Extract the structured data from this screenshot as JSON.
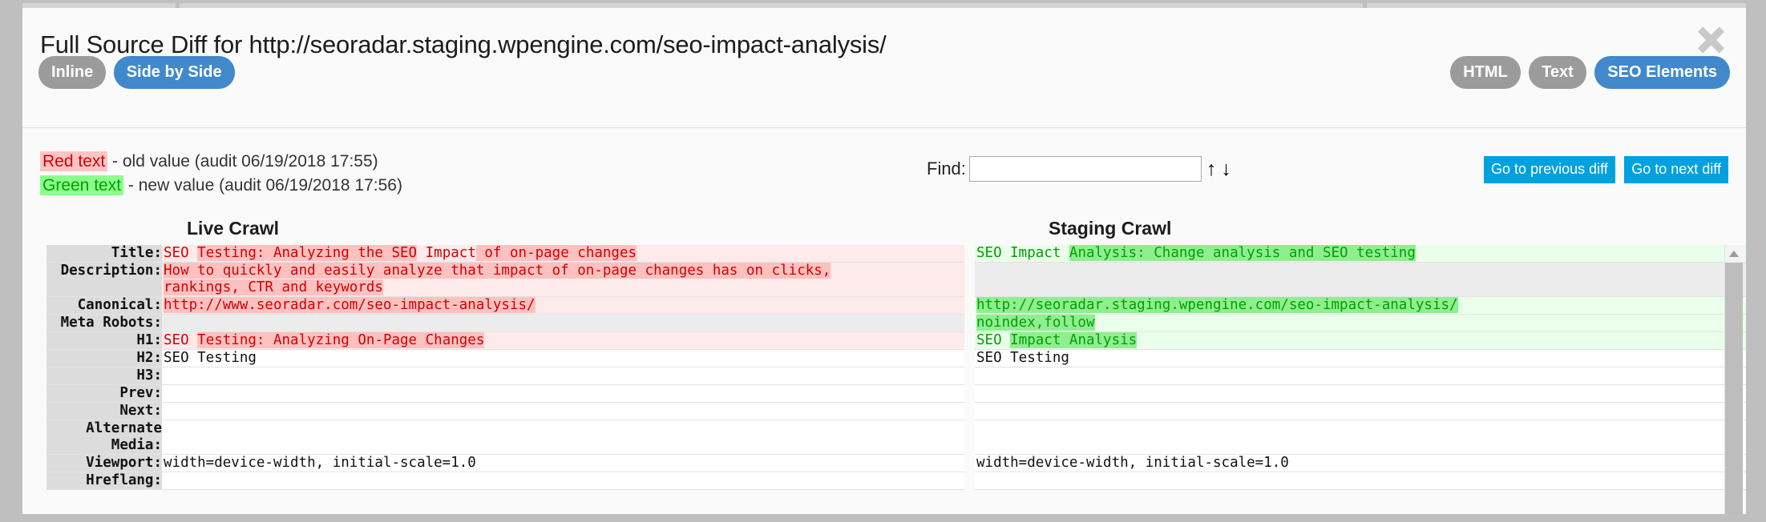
{
  "header": {
    "title": "Full Source Diff for http://seoradar.staging.wpengine.com/seo-impact-analysis/",
    "close_icon": "close-icon",
    "view_modes": [
      {
        "label": "Inline",
        "active": false
      },
      {
        "label": "Side by Side",
        "active": true
      }
    ],
    "format_modes": [
      {
        "label": "HTML",
        "active": false
      },
      {
        "label": "Text",
        "active": false
      },
      {
        "label": "SEO Elements",
        "active": true
      }
    ]
  },
  "toolbar": {
    "legend": [
      {
        "swatch": "Red text",
        "text": " - old value (audit 06/19/2018 17:55)",
        "color": "#d40000",
        "bg": "#ffc4c4"
      },
      {
        "swatch": "Green text",
        "text": " - new value (audit 06/19/2018 17:56)",
        "color": "#00a000",
        "bg": "#8cff8c"
      }
    ],
    "find_label": "Find:",
    "find_value": "",
    "find_placeholder": "",
    "find_up_icon": "↑",
    "find_down_icon": "↓",
    "prev_diff_label": "Go to previous diff",
    "next_diff_label": "Go to next diff"
  },
  "columns": {
    "left_heading": "Live Crawl",
    "right_heading": "Staging Crawl"
  },
  "rows": [
    {
      "label": "Title:",
      "left": {
        "kind": "del",
        "segments": [
          {
            "t": "SEO ",
            "hl": false
          },
          {
            "t": "Testing: Analyzing the SEO",
            "hl": true
          },
          {
            "t": " ",
            "hl": false
          },
          {
            "t": "Impact",
            "hl": false
          },
          {
            "t": " of on-page changes",
            "hl": true
          }
        ]
      },
      "right": {
        "kind": "ins",
        "segments": [
          {
            "t": "SEO Impact ",
            "hl": false
          },
          {
            "t": "Analysis: Change analysis and SEO testing",
            "hl": true
          }
        ]
      }
    },
    {
      "label": "Description:",
      "left": {
        "kind": "del",
        "lines": 2,
        "segments": [
          {
            "t": "How to quickly and easily analyze that impact of on-page changes has on clicks,\nrankings, CTR and keywords",
            "hl": true
          }
        ]
      },
      "right": {
        "kind": "empty-grey",
        "lines": 2,
        "segments": []
      }
    },
    {
      "label": "Canonical:",
      "left": {
        "kind": "del",
        "segments": [
          {
            "t": "http://www.seoradar.com/seo-impact-analysis/",
            "hl": true
          }
        ]
      },
      "right": {
        "kind": "ins",
        "segments": [
          {
            "t": "http://seoradar.staging.wpengine.com/seo-impact-analysis/",
            "hl": true
          }
        ]
      }
    },
    {
      "label": "Meta Robots:",
      "left": {
        "kind": "empty-grey",
        "segments": []
      },
      "right": {
        "kind": "ins",
        "segments": [
          {
            "t": "noindex,follow",
            "hl": true
          }
        ]
      }
    },
    {
      "label": "H1:",
      "left": {
        "kind": "del",
        "segments": [
          {
            "t": "SEO ",
            "hl": false
          },
          {
            "t": "Testing: Analyzing On-Page Changes",
            "hl": true
          }
        ]
      },
      "right": {
        "kind": "ins",
        "segments": [
          {
            "t": "SEO ",
            "hl": false
          },
          {
            "t": "Impact Analysis",
            "hl": true
          }
        ]
      }
    },
    {
      "label": "H2:",
      "left": {
        "kind": "plain",
        "segments": [
          {
            "t": "SEO Testing",
            "hl": false
          }
        ]
      },
      "right": {
        "kind": "plain",
        "segments": [
          {
            "t": "SEO Testing",
            "hl": false
          }
        ]
      }
    },
    {
      "label": "H3:",
      "left": {
        "kind": "plain",
        "segments": []
      },
      "right": {
        "kind": "plain",
        "segments": []
      }
    },
    {
      "label": "Prev:",
      "left": {
        "kind": "plain",
        "segments": []
      },
      "right": {
        "kind": "plain",
        "segments": []
      }
    },
    {
      "label": "Next:",
      "left": {
        "kind": "plain",
        "segments": []
      },
      "right": {
        "kind": "plain",
        "segments": []
      }
    },
    {
      "label": "Alternate\nMedia:",
      "left": {
        "kind": "plain",
        "lines": 2,
        "segments": []
      },
      "right": {
        "kind": "plain",
        "lines": 2,
        "segments": []
      }
    },
    {
      "label": "Viewport:",
      "left": {
        "kind": "plain",
        "segments": [
          {
            "t": "width=device-width, initial-scale=1.0",
            "hl": false
          }
        ]
      },
      "right": {
        "kind": "plain",
        "segments": [
          {
            "t": "width=device-width, initial-scale=1.0",
            "hl": false
          }
        ]
      }
    },
    {
      "label": "Hreflang:",
      "left": {
        "kind": "plain",
        "segments": []
      },
      "right": {
        "kind": "plain",
        "segments": []
      }
    }
  ],
  "scrollbar": {
    "up_icon": "scroll-up-arrow",
    "thumb": "scroll-thumb"
  }
}
